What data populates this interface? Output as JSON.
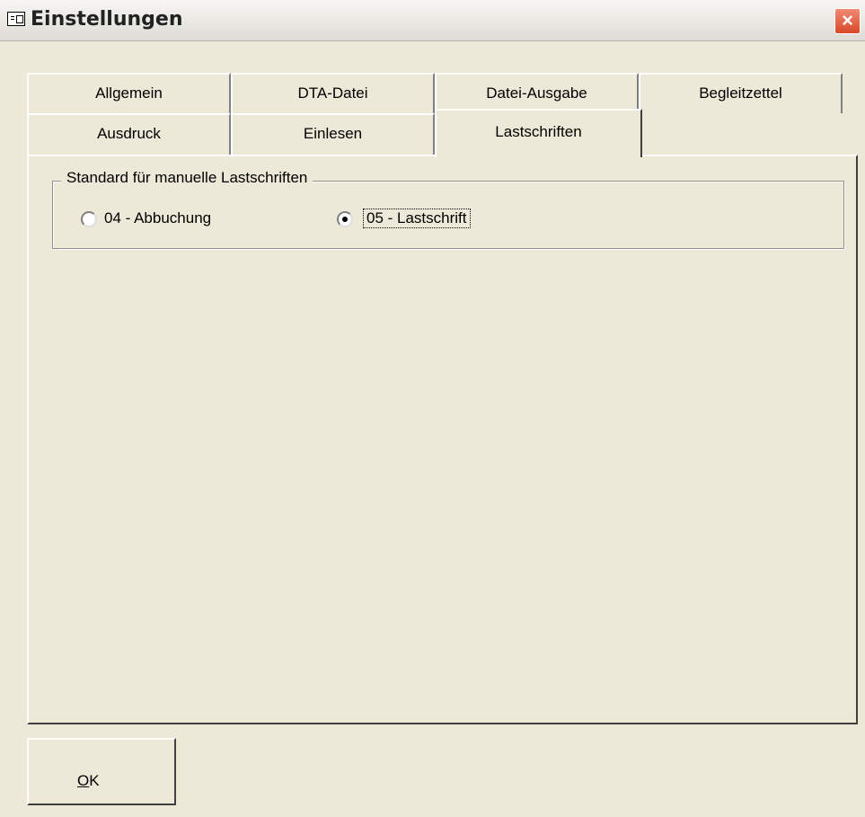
{
  "window": {
    "title": "Einstellungen",
    "close_symbol": "×",
    "icon": "form-icon"
  },
  "tabs": {
    "row1": [
      {
        "label": "Allgemein"
      },
      {
        "label": "DTA-Datei"
      },
      {
        "label": "Datei-Ausgabe"
      },
      {
        "label": "Begleitzettel"
      }
    ],
    "row2": [
      {
        "label": "Ausdruck"
      },
      {
        "label": "Einlesen"
      },
      {
        "label": "Lastschriften",
        "selected": true
      }
    ]
  },
  "group": {
    "legend": "Standard für manuelle Lastschriften",
    "options": [
      {
        "label": "04 - Abbuchung",
        "checked": false
      },
      {
        "label": "05 - Lastschrift",
        "checked": true
      }
    ]
  },
  "buttons": {
    "ok_mnemonic": "O",
    "ok_rest": "K"
  }
}
